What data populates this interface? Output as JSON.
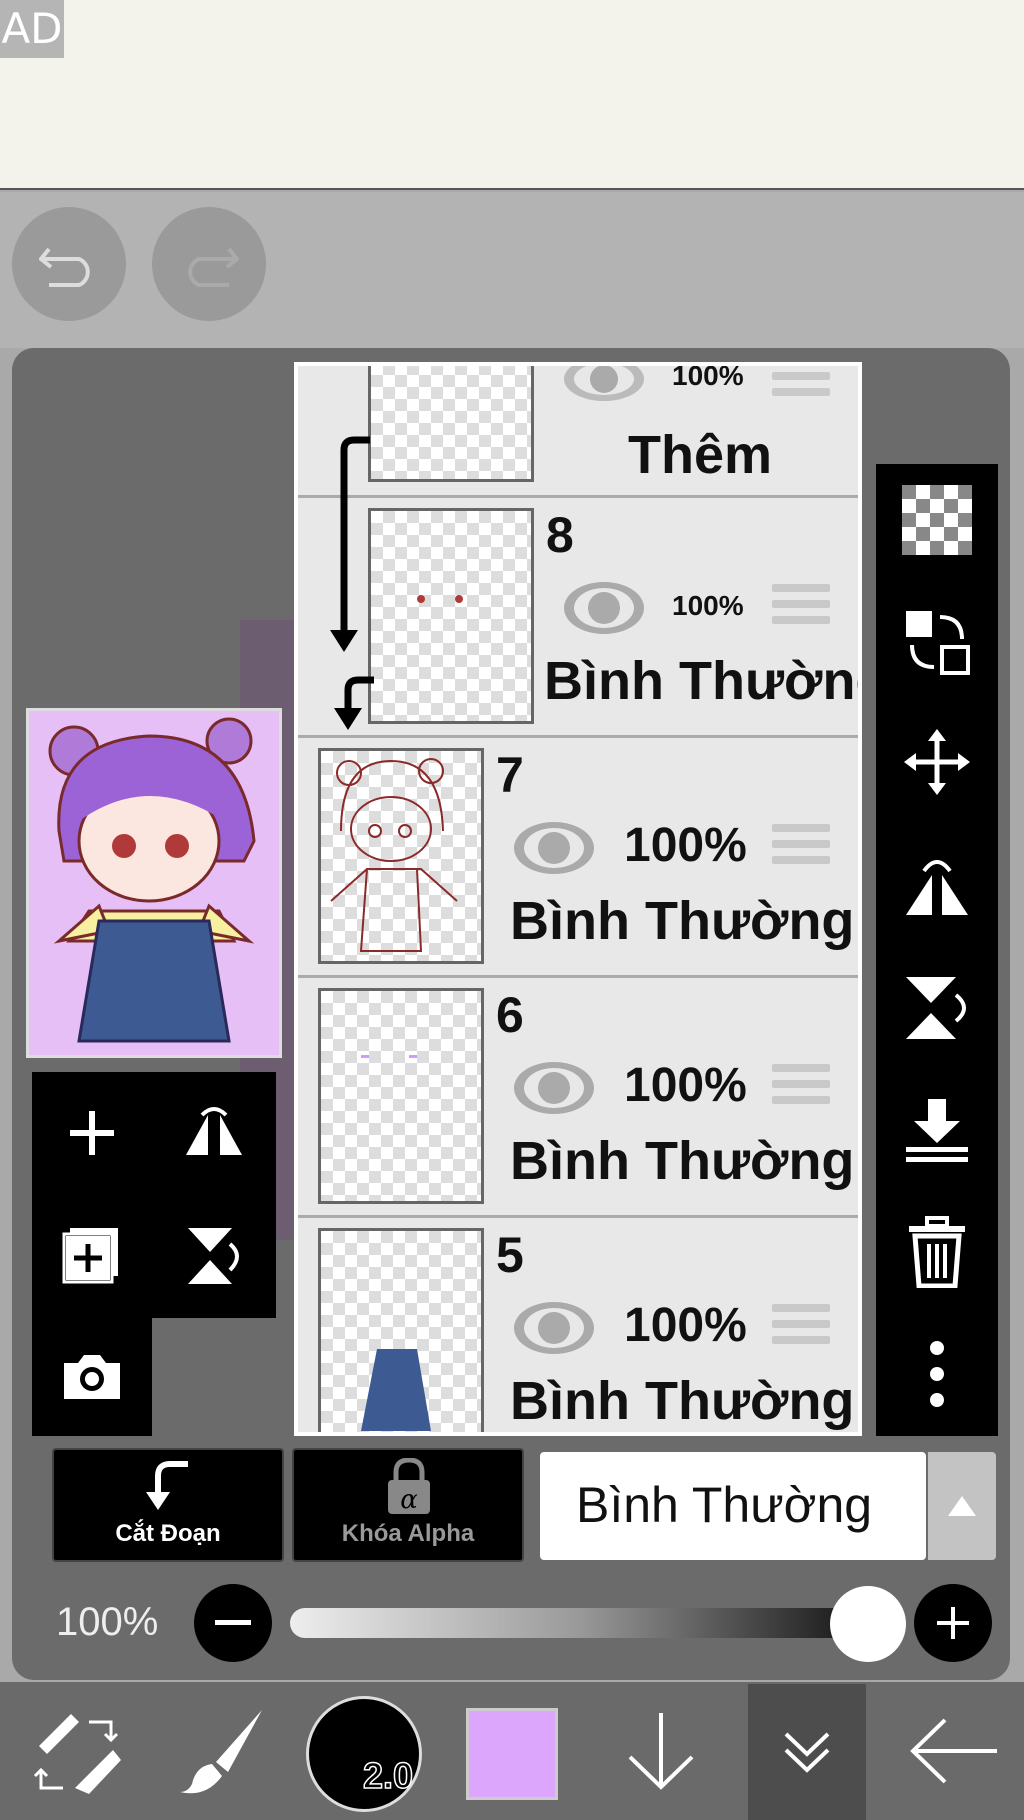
{
  "ad": {
    "label": "AD"
  },
  "layers": [
    {
      "number": "",
      "opacity": "100%",
      "mode": "Thêm"
    },
    {
      "number": "8",
      "opacity": "100%",
      "mode": "Bình Thường"
    },
    {
      "number": "7",
      "opacity": "100%",
      "mode": "Bình Thường"
    },
    {
      "number": "6",
      "opacity": "100%",
      "mode": "Bình Thường"
    },
    {
      "number": "5",
      "opacity": "100%",
      "mode": "Bình Thường"
    }
  ],
  "actions": {
    "clipping_label": "Cắt Đoạn",
    "alpha_lock_label": "Khóa Alpha",
    "blend_mode": "Bình Thường"
  },
  "opacity": {
    "label": "100%",
    "value": 1.0
  },
  "brush": {
    "size": "2.0",
    "color": "#dba6fb"
  },
  "icons": [
    "undo-icon",
    "redo-icon",
    "checker-icon",
    "swap-layers-icon",
    "move-icon",
    "flip-horizontal-icon",
    "flip-vertical-icon",
    "merge-down-icon",
    "trash-icon",
    "more-icon",
    "add-layer-icon",
    "flip-layer-icon",
    "duplicate-layer-icon",
    "flip-vertical-layer-icon",
    "camera-icon",
    "tool-switch-icon",
    "brush-icon",
    "arrow-down-icon",
    "chevron-double-down-icon",
    "back-arrow-icon"
  ]
}
